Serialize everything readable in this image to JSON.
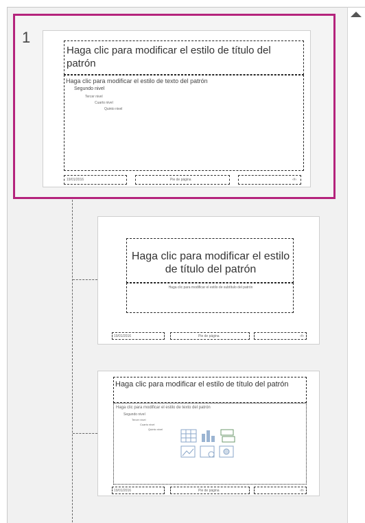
{
  "slides": [
    {
      "number": "1",
      "title": "Haga clic para modificar el estilo de título del patrón",
      "body": {
        "level1": "Haga clic para modificar el estilo de texto del patrón",
        "level2": "Segundo nivel",
        "level3": "Tercer nivel",
        "level4": "Cuarto nivel",
        "level5": "Quinto nivel"
      },
      "footer": {
        "date": "19/01/2016",
        "center": "Pie de página",
        "page": "‹#›"
      }
    },
    {
      "title": "Haga clic para modificar el estilo de título del patrón",
      "subtitle": "Haga clic para modificar el estilo de subtítulo del patrón",
      "footer": {
        "date": "19/01/2016",
        "center": "Pie de página",
        "page": "‹#›"
      }
    },
    {
      "title": "Haga clic para modificar el estilo de título del patrón",
      "body": {
        "level1": "Haga clic para modificar el estilo de texto del patrón",
        "level2": "Segundo nivel",
        "level3": "Tercer nivel",
        "level4": "Cuarto nivel",
        "level5": "Quinto nivel"
      },
      "footer": {
        "date": "19/01/2016",
        "center": "Pie de página",
        "page": "‹#›"
      }
    }
  ],
  "colors": {
    "selection": "#b4237c",
    "pane": "#f1f1f1"
  },
  "icons": [
    "scroll-up-icon",
    "table-icon",
    "chart-icon",
    "smartart-icon",
    "picture-icon",
    "online-picture-icon",
    "video-icon"
  ]
}
